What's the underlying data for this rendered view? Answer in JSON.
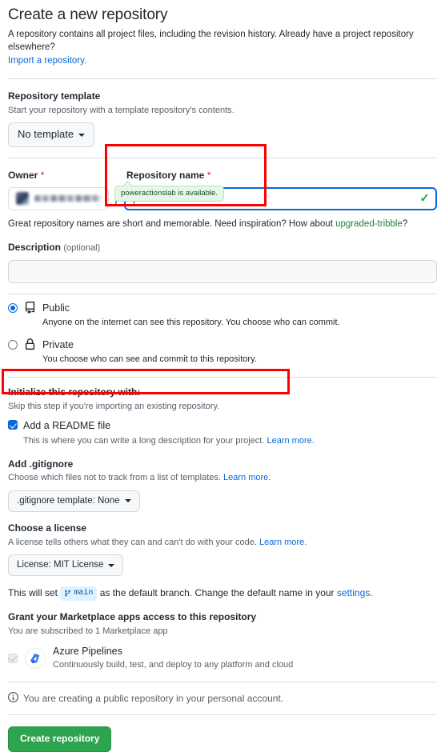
{
  "header": {
    "title": "Create a new repository",
    "subtitle": "A repository contains all project files, including the revision history. Already have a project repository elsewhere?",
    "import_link": "Import a repository."
  },
  "template_section": {
    "label": "Repository template",
    "description": "Start your repository with a template repository's contents.",
    "dropdown_value": "No template"
  },
  "owner_section": {
    "owner_label": "Owner",
    "owner_required_mark": "*",
    "owner_value": "",
    "separator": "/",
    "repo_name_label": "Repository name",
    "repo_name_required_mark": "*",
    "repo_name_value": "poweractionslab",
    "availability_tooltip": "poweractionslab is available.",
    "validation_icon": "check-icon",
    "hint_prefix": "Great repository names are short and memorable. Need inspiration? How about ",
    "hint_suggestion": "upgraded-tribble",
    "hint_suffix": "?"
  },
  "description_section": {
    "label": "Description",
    "optional_text": "(optional)",
    "value": "",
    "placeholder": ""
  },
  "visibility": {
    "options": [
      {
        "id": "public",
        "title": "Public",
        "description": "Anyone on the internet can see this repository. You choose who can commit.",
        "icon": "repo-icon",
        "selected": true
      },
      {
        "id": "private",
        "title": "Private",
        "description": "You choose who can see and commit to this repository.",
        "icon": "lock-icon",
        "selected": false
      }
    ]
  },
  "initialize": {
    "heading": "Initialize this repository with:",
    "subheading": "Skip this step if you're importing an existing repository.",
    "readme": {
      "label": "Add a README file",
      "description": "This is where you can write a long description for your project. ",
      "learn_more": "Learn more.",
      "checked": true
    },
    "gitignore": {
      "label": "Add .gitignore",
      "description": "Choose which files not to track from a list of templates. ",
      "learn_more": "Learn more.",
      "dropdown_value": ".gitignore template: None"
    },
    "license": {
      "label": "Choose a license",
      "description": "A license tells others what they can and can't do with your code. ",
      "learn_more": "Learn more.",
      "dropdown_value": "License: MIT License"
    },
    "branch_note_prefix": "This will set ",
    "branch_name": "main",
    "branch_note_middle": " as the default branch. Change the default name in your ",
    "branch_settings_link": "settings",
    "branch_note_suffix": "."
  },
  "marketplace": {
    "heading": "Grant your Marketplace apps access to this repository",
    "subheading": "You are subscribed to 1 Marketplace app",
    "apps": [
      {
        "name": "Azure Pipelines",
        "description": "Continuously build, test, and deploy to any platform and cloud",
        "icon": "azure-pipelines-icon",
        "checked": true,
        "disabled": true
      }
    ]
  },
  "footer": {
    "info_icon": "info-icon",
    "info_text": "You are creating a public repository in your personal account.",
    "create_button": "Create repository"
  },
  "colors": {
    "accent_blue": "#0969da",
    "success_green": "#2da44e",
    "annotation_red": "#ff0000",
    "link_green": "#1a7f37",
    "required_red": "#cf222e"
  }
}
